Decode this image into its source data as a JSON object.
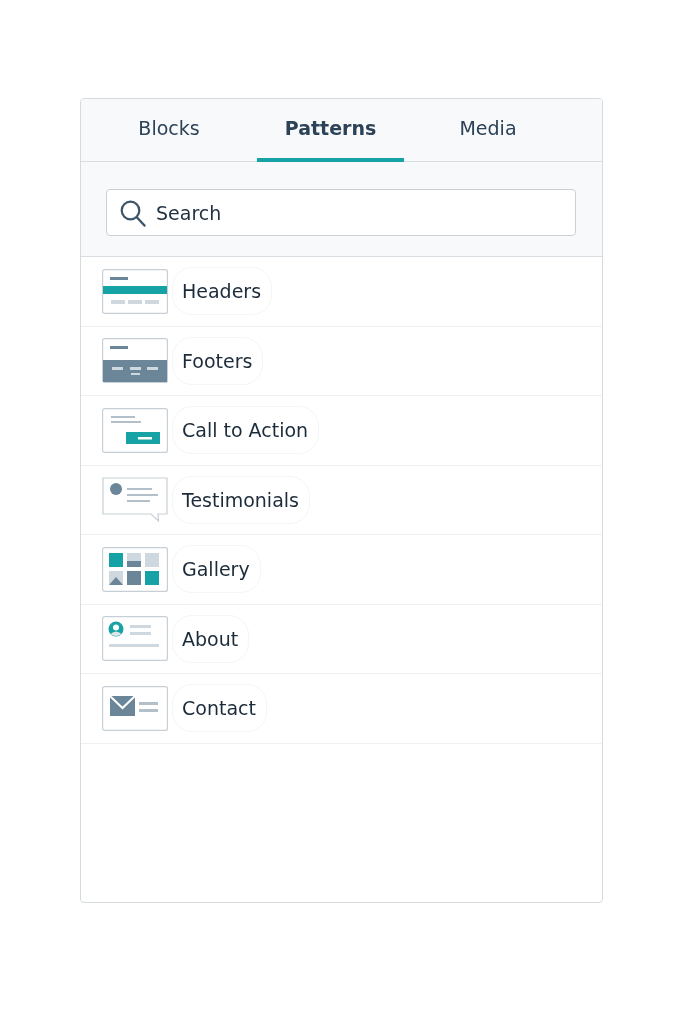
{
  "tabs": [
    {
      "label": "Blocks",
      "selected": false
    },
    {
      "label": "Patterns",
      "selected": true
    },
    {
      "label": "Media",
      "selected": false
    }
  ],
  "search": {
    "placeholder": "Search"
  },
  "categories": [
    {
      "kind": "headers",
      "label": "Headers"
    },
    {
      "kind": "footers",
      "label": "Footers"
    },
    {
      "kind": "call_to_action",
      "label": "Call to Action"
    },
    {
      "kind": "testimonials",
      "label": "Testimonials"
    },
    {
      "kind": "gallery",
      "label": "Gallery"
    },
    {
      "kind": "about",
      "label": "About"
    },
    {
      "kind": "contact",
      "label": "Contact"
    }
  ]
}
